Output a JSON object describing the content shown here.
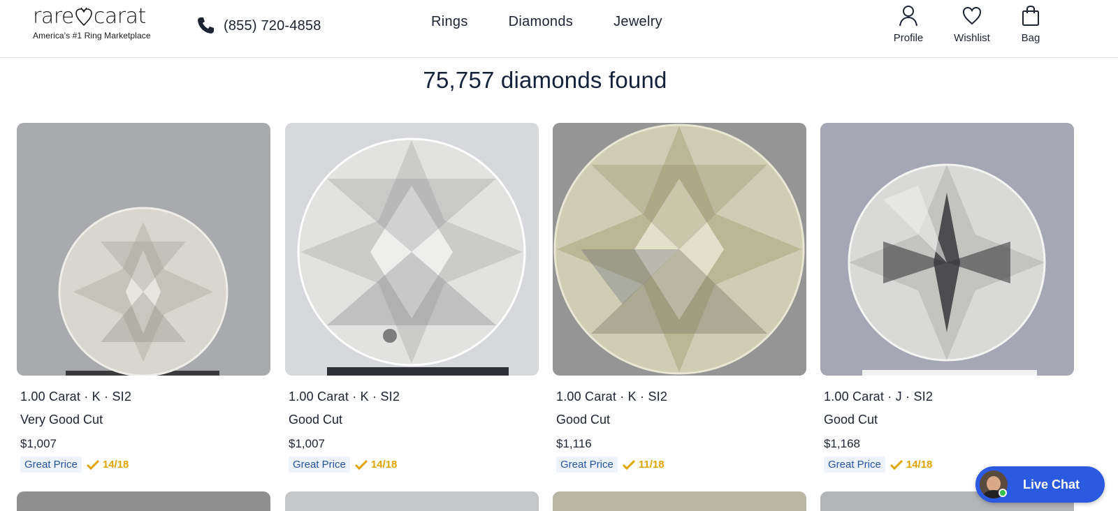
{
  "header": {
    "logo_text_left": "rare",
    "logo_text_right": "carat",
    "tagline": "America's #1 Ring Marketplace",
    "phone": "(855) 720-4858",
    "nav": [
      "Rings",
      "Diamonds",
      "Jewelry"
    ],
    "profile_label": "Profile",
    "wishlist_label": "Wishlist",
    "bag_label": "Bag"
  },
  "results": {
    "title": "75,757 diamonds found"
  },
  "products": [
    {
      "spec": "1.00 Carat · K · SI2",
      "cut": "Very Good Cut",
      "price": "$1,007",
      "badge": "Great Price",
      "score": "14/18"
    },
    {
      "spec": "1.00 Carat · K · SI2",
      "cut": "Good Cut",
      "price": "$1,007",
      "badge": "Great Price",
      "score": "14/18"
    },
    {
      "spec": "1.00 Carat · K · SI2",
      "cut": "Good Cut",
      "price": "$1,116",
      "badge": "Great Price",
      "score": "11/18"
    },
    {
      "spec": "1.00 Carat · J · SI2",
      "cut": "Good Cut",
      "price": "$1,168",
      "badge": "Great Price",
      "score": "14/18"
    }
  ],
  "chat": {
    "label": "Live Chat"
  },
  "colors": {
    "accent": "#2b59e0",
    "badge_text": "#2454a6",
    "score": "#e0a400"
  }
}
